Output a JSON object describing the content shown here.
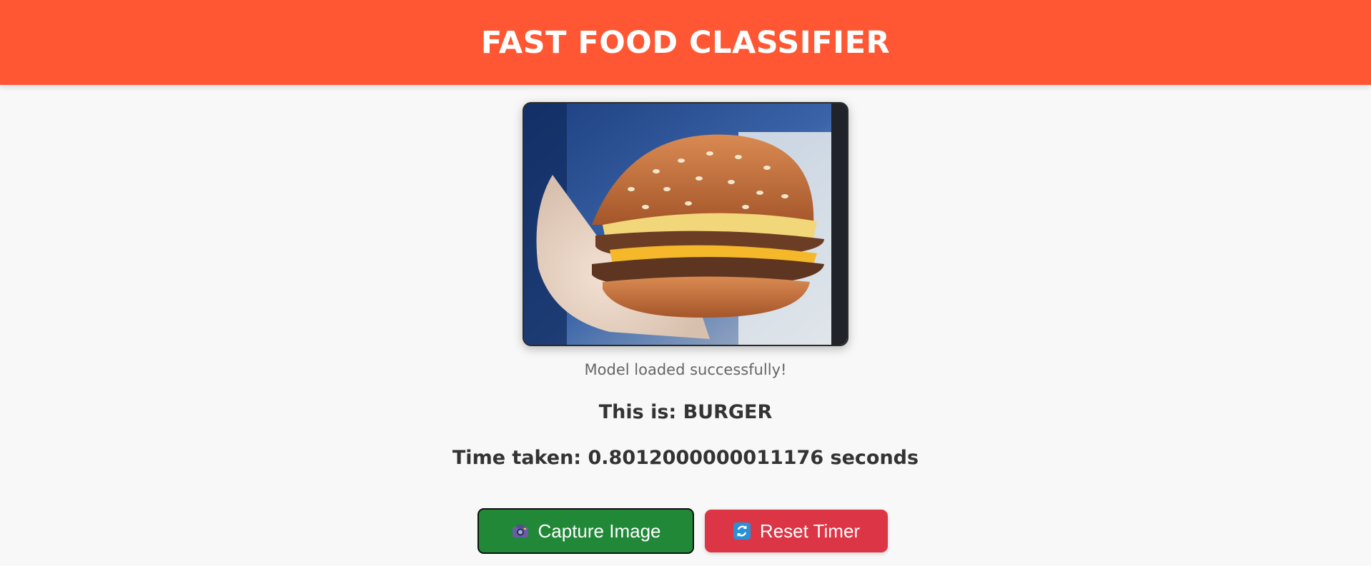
{
  "header": {
    "title": "FAST FOOD CLASSIFIER"
  },
  "camera": {
    "subject": "burger-photo"
  },
  "status": {
    "text": "Model loaded successfully!"
  },
  "result": {
    "prediction": "This is: BURGER",
    "timing": "Time taken: 0.8012000000011176 seconds"
  },
  "buttons": {
    "capture": {
      "label": "Capture Image",
      "icon": "camera-icon",
      "color": "#218838"
    },
    "reset": {
      "label": "Reset Timer",
      "icon": "refresh-icon",
      "color": "#dc3545"
    }
  },
  "colors": {
    "header_bg": "#ff5733",
    "page_bg": "#f8f8f8"
  }
}
